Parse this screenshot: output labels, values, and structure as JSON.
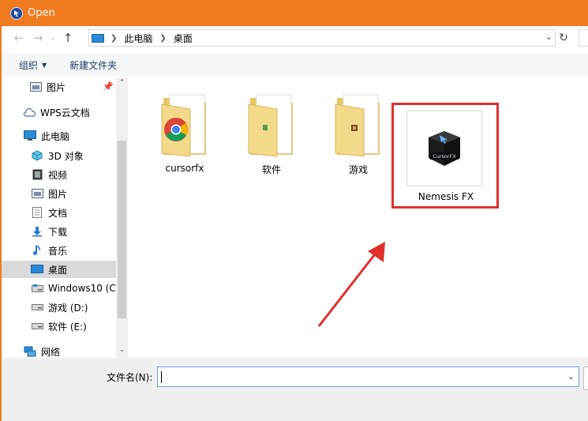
{
  "window": {
    "title": "Open"
  },
  "address": {
    "crumbs": [
      "此电脑",
      "桌面"
    ]
  },
  "toolbar": {
    "organize_label": "组织",
    "new_folder_label": "新建文件夹"
  },
  "sidebar": {
    "items": [
      {
        "label": "图片",
        "icon": "pictures-icon",
        "pinned": true
      },
      {
        "label": "WPS云文档",
        "icon": "cloud-icon"
      },
      {
        "label": "此电脑",
        "icon": "pc-icon"
      },
      {
        "label": "3D 对象",
        "icon": "3d-objects-icon"
      },
      {
        "label": "视频",
        "icon": "video-icon"
      },
      {
        "label": "图片",
        "icon": "pictures-icon"
      },
      {
        "label": "文档",
        "icon": "documents-icon"
      },
      {
        "label": "下载",
        "icon": "download-icon"
      },
      {
        "label": "音乐",
        "icon": "music-icon"
      },
      {
        "label": "桌面",
        "icon": "desktop-icon",
        "selected": true
      },
      {
        "label": "Windows10 (C:",
        "icon": "drive-icon"
      },
      {
        "label": "游戏 (D:)",
        "icon": "drive-icon"
      },
      {
        "label": "软件 (E:)",
        "icon": "drive-icon"
      },
      {
        "label": "网络",
        "icon": "network-icon"
      }
    ]
  },
  "files": [
    {
      "name": "cursorfx",
      "icon": "folder-chrome-icon"
    },
    {
      "name": "软件",
      "icon": "folder-icon"
    },
    {
      "name": "游戏",
      "icon": "folder-icon"
    },
    {
      "name": "Nemesis FX",
      "icon": "cursorfx-app-icon",
      "highlighted": true,
      "thumb_text": "CursorFX"
    }
  ],
  "bottom": {
    "filename_label": "文件名(N):",
    "filename_value": ""
  },
  "colors": {
    "title_bar": "#f07a1f",
    "highlight": "#e0302e",
    "selection": "#d9d9d9"
  }
}
